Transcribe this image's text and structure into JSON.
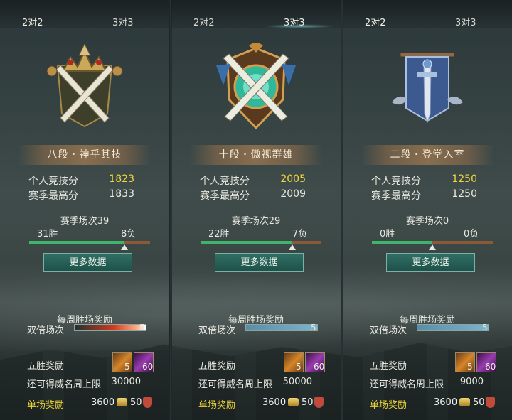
{
  "panels": [
    {
      "tabs": [
        "2对2",
        "3对3"
      ],
      "active_tab": 0,
      "rank_title": "八段・神乎其技",
      "emblem_icon": "crossed-swords-crown-emblem",
      "score_label": "个人竞技分",
      "score_value": "1823",
      "season_high_label": "赛季最高分",
      "season_high_value": "1833",
      "season_matches": "赛季场次39",
      "wins": "31胜",
      "losses": "8负",
      "win_ratio": 0.79,
      "more_button": "更多数据",
      "weekly_reward_label": "每周胜场奖励",
      "double_label": "双倍场次",
      "double_count": "5",
      "double_progress": 1.0,
      "five_win_label": "五胜奖励",
      "item1_count": "5",
      "item2_count": "60",
      "cap_label": "还可得威名周上限",
      "cap_value": "30000",
      "single_reward_label": "单场奖励",
      "single_money": "3600",
      "single_honor": "50"
    },
    {
      "tabs": [
        "2对2",
        "3对3"
      ],
      "active_tab": 1,
      "rank_title": "十段・傲视群雄",
      "emblem_icon": "crossed-swords-jade-shield-emblem",
      "score_label": "个人竞技分",
      "score_value": "2005",
      "season_high_label": "赛季最高分",
      "season_high_value": "2009",
      "season_matches": "赛季场次29",
      "wins": "22胜",
      "losses": "7负",
      "win_ratio": 0.76,
      "more_button": "更多数据",
      "weekly_reward_label": "每周胜场奖励",
      "double_label": "双倍场次",
      "double_count": "5",
      "double_progress": 1.0,
      "five_win_label": "五胜奖励",
      "item1_count": "5",
      "item2_count": "60",
      "cap_label": "还可得威名周上限",
      "cap_value": "50000",
      "single_reward_label": "单场奖励",
      "single_money": "3600",
      "single_honor": "50"
    },
    {
      "tabs": [
        "2对2",
        "3对3"
      ],
      "active_tab": 0,
      "rank_title": "二段・登堂入室",
      "emblem_icon": "sword-banner-emblem",
      "score_label": "个人竞技分",
      "score_value": "1250",
      "season_high_label": "赛季最高分",
      "season_high_value": "1250",
      "season_matches": "赛季场次0",
      "wins": "0胜",
      "losses": "0负",
      "win_ratio": 0.5,
      "more_button": "更多数据",
      "weekly_reward_label": "每周胜场奖励",
      "double_label": "双倍场次",
      "double_count": "5",
      "double_progress": 1.0,
      "five_win_label": "五胜奖励",
      "item1_count": "5",
      "item2_count": "60",
      "cap_label": "还可得威名周上限",
      "cap_value": "9000",
      "single_reward_label": "单场奖励",
      "single_money": "3600",
      "single_honor": "50"
    }
  ],
  "colors": {
    "score_highlight": "#f2d53c",
    "win_bar": "#3fb56c",
    "loss_bar": "#8a5a38",
    "button": "#2f6f64",
    "single_reward_text": "#e8d23a"
  }
}
